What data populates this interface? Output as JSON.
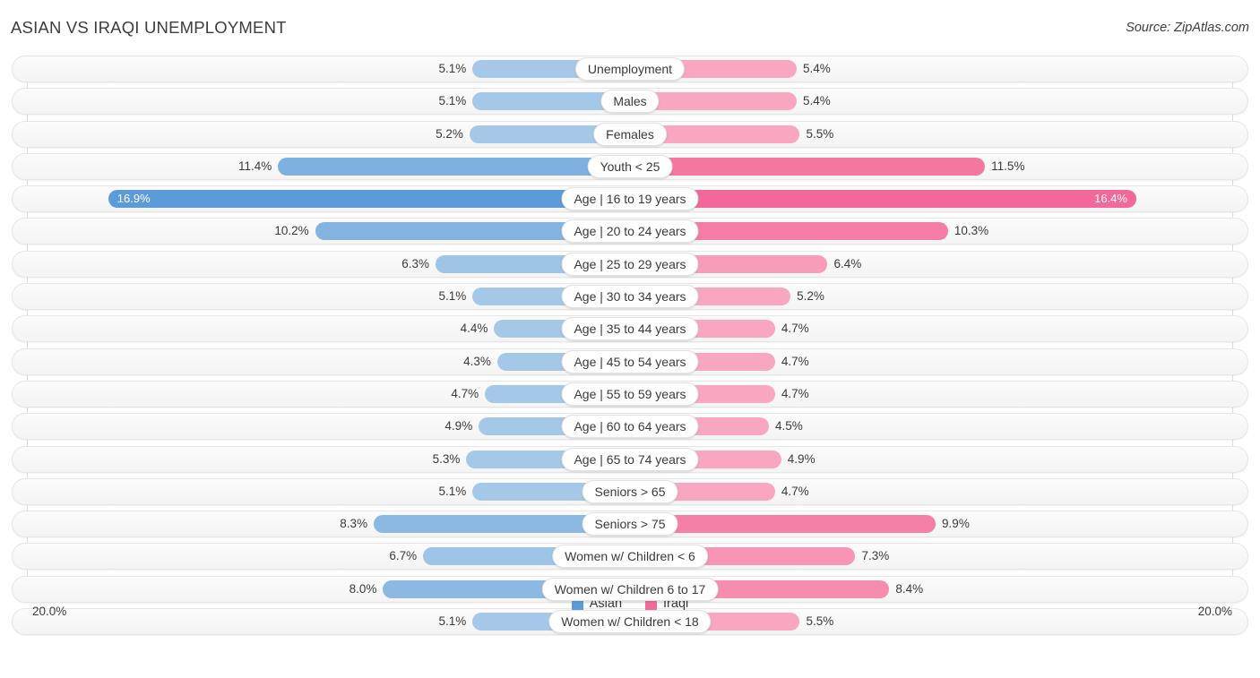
{
  "header": {
    "title": "ASIAN VS IRAQI UNEMPLOYMENT",
    "source": "Source: ZipAtlas.com"
  },
  "axis": {
    "left_max_label": "20.0%",
    "right_max_label": "20.0%",
    "max_value": 20.0
  },
  "legend": {
    "items": [
      {
        "label": "Asian",
        "color": "#5b9bd9",
        "name": "legend-asian"
      },
      {
        "label": "Iraqi",
        "color": "#f2689a",
        "name": "legend-iraqi"
      }
    ]
  },
  "colors": {
    "asian_light": "#a6c8e8",
    "asian_mid": "#7eb1e0",
    "asian_strong": "#5b9bd9",
    "iraqi_light": "#f9a7c0",
    "iraqi_mid": "#f58cae",
    "iraqi_strong": "#f2689a",
    "track_bg": "#f6f6f6",
    "grid": "#dcdcdc",
    "text": "#3a3a3a"
  },
  "chart_data": {
    "type": "bar",
    "subtype": "diverging-bidirectional",
    "title": "ASIAN VS IRAQI UNEMPLOYMENT",
    "xlabel": "",
    "ylabel": "",
    "xlim": [
      20.0,
      20.0
    ],
    "grid": true,
    "legend_position": "bottom-center",
    "unit": "%",
    "categories": [
      "Unemployment",
      "Males",
      "Females",
      "Youth < 25",
      "Age | 16 to 19 years",
      "Age | 20 to 24 years",
      "Age | 25 to 29 years",
      "Age | 30 to 34 years",
      "Age | 35 to 44 years",
      "Age | 45 to 54 years",
      "Age | 55 to 59 years",
      "Age | 60 to 64 years",
      "Age | 65 to 74 years",
      "Seniors > 65",
      "Seniors > 75",
      "Women w/ Children < 6",
      "Women w/ Children 6 to 17",
      "Women w/ Children < 18"
    ],
    "series": [
      {
        "name": "Asian",
        "color": "#5b9bd9",
        "side": "left",
        "values": [
          5.1,
          5.1,
          5.2,
          11.4,
          16.9,
          10.2,
          6.3,
          5.1,
          4.4,
          4.3,
          4.7,
          4.9,
          5.3,
          5.1,
          8.3,
          6.7,
          8.0,
          5.1
        ]
      },
      {
        "name": "Iraqi",
        "color": "#f2689a",
        "side": "right",
        "values": [
          5.4,
          5.4,
          5.5,
          11.5,
          16.4,
          10.3,
          6.4,
          5.2,
          4.7,
          4.7,
          4.7,
          4.5,
          4.9,
          4.7,
          9.9,
          7.3,
          8.4,
          5.5
        ]
      }
    ]
  },
  "rows": [
    {
      "label": "Unemployment",
      "left_value": 5.1,
      "right_value": 5.4,
      "left_label": "5.1%",
      "right_label": "5.4%",
      "left_color": "#a6c8e8",
      "right_color": "#f9a7c0",
      "labels_inside": false
    },
    {
      "label": "Males",
      "left_value": 5.1,
      "right_value": 5.4,
      "left_label": "5.1%",
      "right_label": "5.4%",
      "left_color": "#a6c8e8",
      "right_color": "#f9a7c0",
      "labels_inside": false
    },
    {
      "label": "Females",
      "left_value": 5.2,
      "right_value": 5.5,
      "left_label": "5.2%",
      "right_label": "5.5%",
      "left_color": "#a6c8e8",
      "right_color": "#f9a7c0",
      "labels_inside": false
    },
    {
      "label": "Youth < 25",
      "left_value": 11.4,
      "right_value": 11.5,
      "left_label": "11.4%",
      "right_label": "11.5%",
      "left_color": "#7eb1e0",
      "right_color": "#f4779f",
      "labels_inside": false
    },
    {
      "label": "Age | 16 to 19 years",
      "left_value": 16.9,
      "right_value": 16.4,
      "left_label": "16.9%",
      "right_label": "16.4%",
      "left_color": "#5b9bd9",
      "right_color": "#f2689a",
      "labels_inside": true
    },
    {
      "label": "Age | 20 to 24 years",
      "left_value": 10.2,
      "right_value": 10.3,
      "left_label": "10.2%",
      "right_label": "10.3%",
      "left_color": "#82b3e1",
      "right_color": "#f57ca6",
      "labels_inside": false
    },
    {
      "label": "Age | 25 to 29 years",
      "left_value": 6.3,
      "right_value": 6.4,
      "left_label": "6.3%",
      "right_label": "6.4%",
      "left_color": "#9ec4e7",
      "right_color": "#f99cba",
      "labels_inside": false
    },
    {
      "label": "Age | 30 to 34 years",
      "left_value": 5.1,
      "right_value": 5.2,
      "left_label": "5.1%",
      "right_label": "5.2%",
      "left_color": "#a6c8e8",
      "right_color": "#f9a7c0",
      "labels_inside": false
    },
    {
      "label": "Age | 35 to 44 years",
      "left_value": 4.4,
      "right_value": 4.7,
      "left_label": "4.4%",
      "right_label": "4.7%",
      "left_color": "#a6c8e8",
      "right_color": "#f9a7c0",
      "labels_inside": false
    },
    {
      "label": "Age | 45 to 54 years",
      "left_value": 4.3,
      "right_value": 4.7,
      "left_label": "4.3%",
      "right_label": "4.7%",
      "left_color": "#a6c8e8",
      "right_color": "#f9a7c0",
      "labels_inside": false
    },
    {
      "label": "Age | 55 to 59 years",
      "left_value": 4.7,
      "right_value": 4.7,
      "left_label": "4.7%",
      "right_label": "4.7%",
      "left_color": "#a6c8e8",
      "right_color": "#f9a7c0",
      "labels_inside": false
    },
    {
      "label": "Age | 60 to 64 years",
      "left_value": 4.9,
      "right_value": 4.5,
      "left_label": "4.9%",
      "right_label": "4.5%",
      "left_color": "#a6c8e8",
      "right_color": "#f9a7c0",
      "labels_inside": false
    },
    {
      "label": "Age | 65 to 74 years",
      "left_value": 5.3,
      "right_value": 4.9,
      "left_label": "5.3%",
      "right_label": "4.9%",
      "left_color": "#a6c8e8",
      "right_color": "#f9a7c0",
      "labels_inside": false
    },
    {
      "label": "Seniors > 65",
      "left_value": 5.1,
      "right_value": 4.7,
      "left_label": "5.1%",
      "right_label": "4.7%",
      "left_color": "#a6c8e8",
      "right_color": "#f9a7c0",
      "labels_inside": false
    },
    {
      "label": "Seniors > 75",
      "left_value": 8.3,
      "right_value": 9.9,
      "left_label": "8.3%",
      "right_label": "9.9%",
      "left_color": "#8cb9e3",
      "right_color": "#f67fa8",
      "labels_inside": false
    },
    {
      "label": "Women w/ Children < 6",
      "left_value": 6.7,
      "right_value": 7.3,
      "left_label": "6.7%",
      "right_label": "7.3%",
      "left_color": "#9ec4e7",
      "right_color": "#f895b5",
      "labels_inside": false
    },
    {
      "label": "Women w/ Children 6 to 17",
      "left_value": 8.0,
      "right_value": 8.4,
      "left_label": "8.0%",
      "right_label": "8.4%",
      "left_color": "#8cb9e3",
      "right_color": "#f68cae",
      "labels_inside": false
    },
    {
      "label": "Women w/ Children < 18",
      "left_value": 5.1,
      "right_value": 5.5,
      "left_label": "5.1%",
      "right_label": "5.5%",
      "left_color": "#a6c8e8",
      "right_color": "#f9a7c0",
      "labels_inside": false
    }
  ]
}
